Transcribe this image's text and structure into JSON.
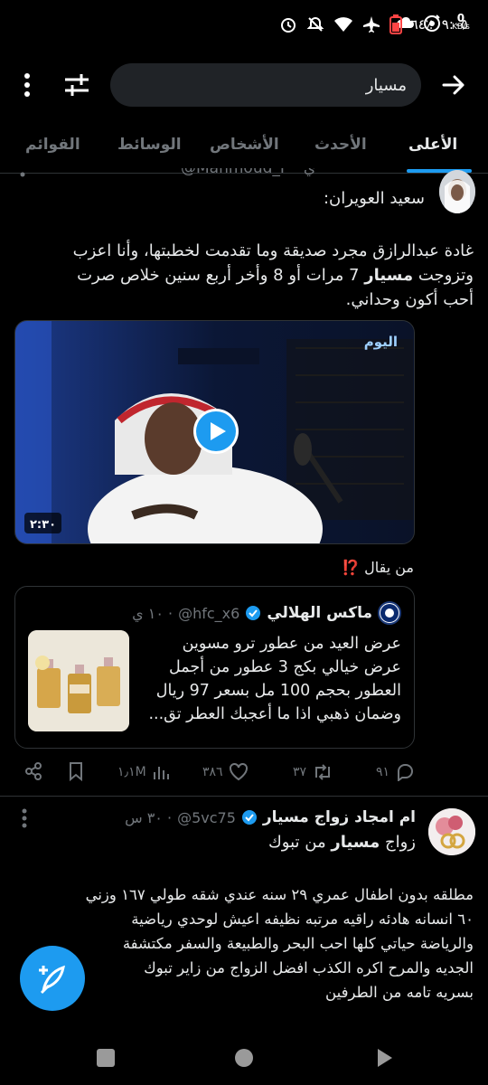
{
  "status": {
    "time": "٩:٠٥",
    "battery": "٦٤٪",
    "net_speed_value": "0",
    "net_speed_unit": "KB/s"
  },
  "search": {
    "query": "مسيار"
  },
  "tabs": [
    {
      "label": "الأعلى",
      "active": true
    },
    {
      "label": "الأحدث",
      "active": false
    },
    {
      "label": "الأشخاص",
      "active": false
    },
    {
      "label": "الوسائط",
      "active": false
    },
    {
      "label": "القوائم",
      "active": false
    }
  ],
  "tweet1": {
    "header_partial": "@Mahmoud_F · ي",
    "line1": "سعيد العويران:",
    "body_line1": "غادة عبدالرازق مجرد صديقة وما تقدمت لخطبتها، وأنا اعزب",
    "body_line2_pre": "وتزوجت ",
    "body_line2_bold": "مسيار",
    "body_line2_post": " 7 مرات أو 8 وأخر أربع سنين خلاص صرت",
    "body_line3": "أحب أكون وحداني.",
    "video_channel": "اليوم",
    "video_duration": "٢:٣٠",
    "quote_intro": "من يقال ⁉️",
    "quote": {
      "name": "ماكس الهلالي",
      "handle": "@hfc_x6",
      "time": "· ١٠ ي",
      "line1": "عرض العيد من عطور ترو مسوين",
      "line2": "عرض خيالي بكج 3 عطور من أجمل",
      "line3": "العطور بحجم 100 مل بسعر 97 ريال",
      "line4": "وضمان ذهبي اذا ما أعجبك العطر تق..."
    },
    "actions": {
      "replies": "٩١",
      "retweets": "٣٧",
      "likes": "٣٨٦",
      "views": "١٫١M"
    }
  },
  "tweet2": {
    "name": "ام امجاد زواج مسيار",
    "handle": "@5vc75",
    "time": "· ٣٠ س",
    "line1_pre": "زواج ",
    "line1_bold": "مسيار",
    "line1_post": " من تبوك",
    "body1": "مطلقه بدون اطفال عمري ٢٩ سنه عندي شقه طولي ١٦٧ وزني",
    "body2": "٦٠ انسانه هادئه راقيه مرتبه نظيفه اعيش لوحدي رياضية",
    "body3": "والرياضة حياتي كلها احب البحر  والطبيعة والسفر مكتشفة",
    "body4": "الجديه والمرح اكره الكذب افضل الزواج من زاير تبوك",
    "body5": "بسريه تامه من الطرفين"
  },
  "colors": {
    "accent": "#1d9bf0",
    "background": "#000000",
    "text": "#e7e9ea",
    "muted": "#71767b",
    "like_red": "#f4212e"
  }
}
